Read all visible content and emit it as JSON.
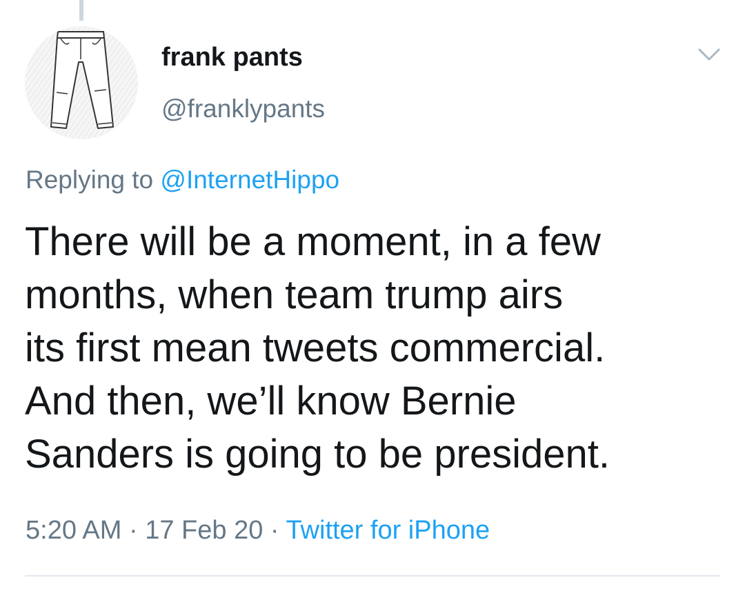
{
  "tweet": {
    "author": {
      "display_name": "frank pants",
      "handle": "@franklypants",
      "avatar_icon": "pants-icon"
    },
    "menu_icon": "chevron-down-icon",
    "replying_prefix": "Replying to",
    "replying_to": "@InternetHippo",
    "text_lines": [
      "There will be a moment, in a few",
      "months, when team trump airs",
      "its first mean tweets commercial.",
      "And then, we’ll know Bernie",
      "Sanders is going to be president."
    ],
    "meta": {
      "time": "5:20 AM",
      "separator": "·",
      "date": "17 Feb 20",
      "source": "Twitter for iPhone"
    }
  },
  "colors": {
    "text": "#14171a",
    "secondary": "#657786",
    "link": "#1da1f2",
    "divider": "#e1e8ed"
  }
}
